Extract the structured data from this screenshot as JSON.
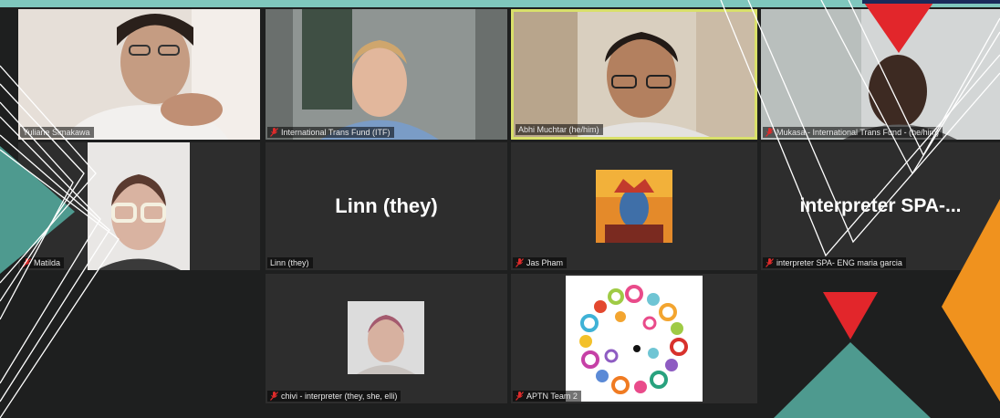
{
  "colors": {
    "top_bar": "#7fc7bd",
    "speaking_border": "#d9e06a",
    "muted_icon": "#e02b2b",
    "deco_red": "#e2262b",
    "deco_teal": "#4e9a8f",
    "deco_orange": "#f0921e"
  },
  "participants": [
    {
      "name": "Yuliane Simakawa",
      "muted": false
    },
    {
      "name": "International Trans Fund (ITF)",
      "muted": true
    },
    {
      "name": "Abhi Muchtar (he/him)",
      "muted": false,
      "speaking": true
    },
    {
      "name": "Mukasa - International Trans Fund - (he/him)",
      "muted": true
    },
    {
      "name": "Matilda",
      "muted": true
    },
    {
      "name": "Linn (they)",
      "muted": false,
      "display_name": "Linn (they)"
    },
    {
      "name": "Jas Pham",
      "muted": true
    },
    {
      "name": "interpreter SPA- ENG maria garcia",
      "muted": true,
      "display_name": "interpreter  SPA-..."
    },
    {
      "name": "chivi - interpreter (they, she, elli)",
      "muted": true
    },
    {
      "name": "APTN Team 2",
      "muted": true
    }
  ]
}
